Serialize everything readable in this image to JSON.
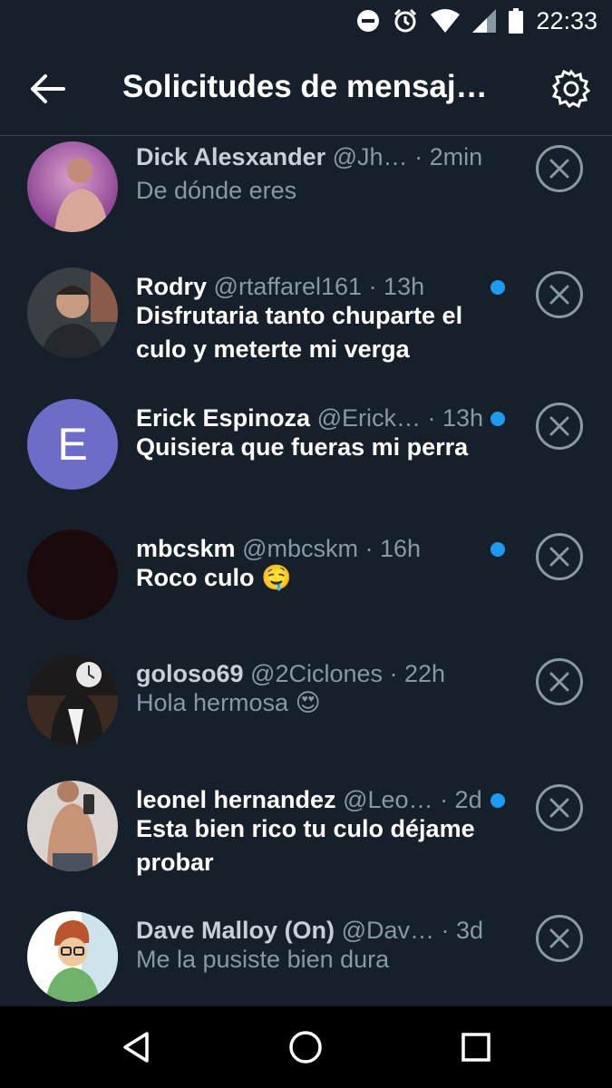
{
  "status_bar": {
    "time": "22:33"
  },
  "header": {
    "title": "Solicitudes de mensaj…"
  },
  "requests": [
    {
      "name": "Dick Alesxander",
      "handle": "@Jh…",
      "time": "· 2min",
      "message": "De dónde eres",
      "unread": false
    },
    {
      "name": "Rodry",
      "handle": "@rtaffarel161",
      "time": "· 13h",
      "message": "Disfrutaria tanto chuparte el culo y meterte mi verga",
      "unread": true
    },
    {
      "name": "Erick Espinoza",
      "handle": "@Erick…",
      "time": "· 13h",
      "message": "Quisiera que fueras mi perra",
      "unread": true,
      "avatar_letter": "E"
    },
    {
      "name": "mbcskm",
      "handle": "@mbcskm",
      "time": "· 16h",
      "message": "Roco culo 🤤",
      "unread": true
    },
    {
      "name": "goloso69",
      "handle": "@2Ciclones",
      "time": "· 22h",
      "message": "Hola hermosa 😍",
      "unread": false
    },
    {
      "name": "leonel hernandez",
      "handle": "@Leo…",
      "time": "· 2d",
      "message": "Esta bien rico tu culo déjame probar",
      "unread": true
    },
    {
      "name": "Dave Malloy (On)",
      "handle": "@Dav…",
      "time": "· 3d",
      "message": "Me la pusiste bien dura",
      "unread": false
    }
  ],
  "colors": {
    "background": "#15202b",
    "accent": "#1d9bf0",
    "muted": "#8899a6",
    "letter_avatar": "#6d6cc9"
  },
  "icons": [
    "back-arrow-icon",
    "gear-icon",
    "close-icon",
    "triangle-back-icon",
    "circle-home-icon",
    "square-recents-icon",
    "dnd-icon",
    "alarm-icon",
    "wifi-icon",
    "signal-icon",
    "battery-icon"
  ]
}
